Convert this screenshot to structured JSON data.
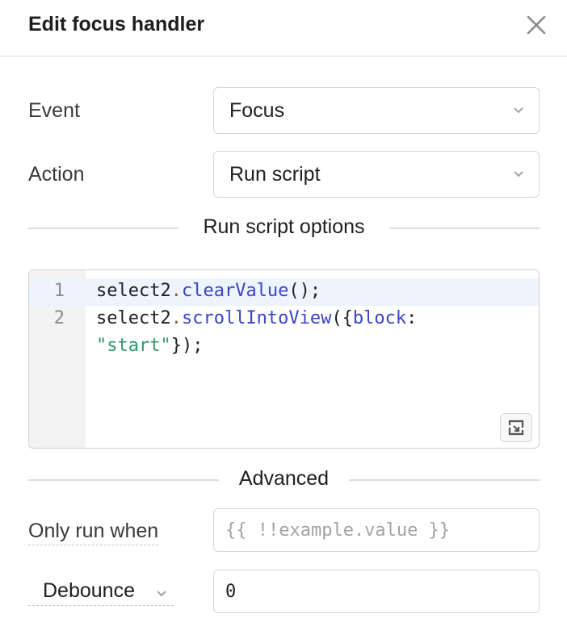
{
  "header": {
    "title": "Edit focus handler"
  },
  "form": {
    "event": {
      "label": "Event",
      "value": "Focus"
    },
    "action": {
      "label": "Action",
      "value": "Run script"
    }
  },
  "script_section": {
    "heading": "Run script options"
  },
  "editor": {
    "line_numbers": [
      "1",
      "2"
    ],
    "lines": {
      "l1": {
        "obj": "select2",
        "dot": ".",
        "method": "clearValue",
        "tail": "();"
      },
      "l2": {
        "obj": "select2",
        "dot": ".",
        "method": "scrollIntoView",
        "open": "({",
        "key": "block",
        "colon": ":"
      },
      "l3": {
        "str": "\"start\"",
        "tail": "});"
      }
    }
  },
  "advanced": {
    "heading": "Advanced",
    "only_run_when": {
      "label": "Only run when",
      "placeholder": "{{ !!example.value }}",
      "value": ""
    },
    "debounce": {
      "label": "Debounce",
      "value": "0"
    }
  },
  "icons": {
    "close": "close-icon",
    "dropdown": "chevron-down-icon",
    "expand": "expand-editor-icon"
  }
}
